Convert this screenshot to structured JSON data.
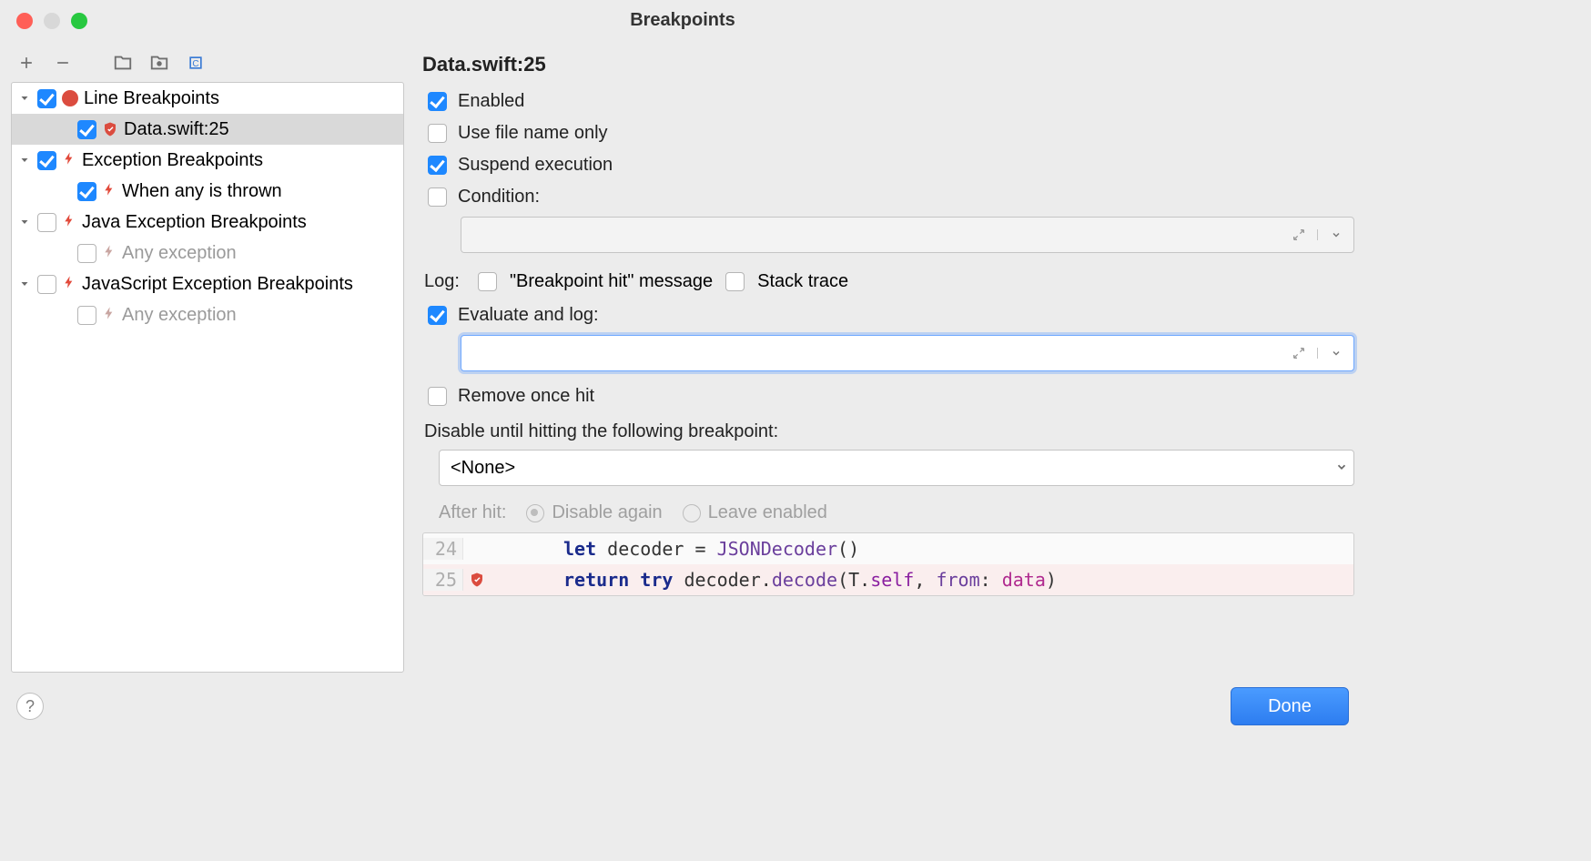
{
  "window": {
    "title": "Breakpoints"
  },
  "tree": {
    "groups": [
      {
        "label": "Line Breakpoints",
        "checked": true,
        "icon": "dot",
        "expanded": true,
        "children": [
          {
            "label": "Data.swift:25",
            "checked": true,
            "icon": "shield",
            "selected": true
          }
        ]
      },
      {
        "label": "Exception Breakpoints",
        "checked": true,
        "icon": "lightning",
        "expanded": true,
        "children": [
          {
            "label": "When any is thrown",
            "checked": true,
            "icon": "lightning"
          }
        ]
      },
      {
        "label": "Java Exception Breakpoints",
        "checked": false,
        "icon": "lightning",
        "expanded": true,
        "children": [
          {
            "label": "Any exception",
            "checked": false,
            "icon": "lightning",
            "muted": true
          }
        ]
      },
      {
        "label": "JavaScript Exception Breakpoints",
        "checked": false,
        "icon": "lightning",
        "expanded": true,
        "children": [
          {
            "label": "Any exception",
            "checked": false,
            "icon": "lightning",
            "muted": true
          }
        ]
      }
    ]
  },
  "detail": {
    "title": "Data.swift:25",
    "enabled_label": "Enabled",
    "enabled": true,
    "filename_only_label": "Use file name only",
    "filename_only": false,
    "suspend_label": "Suspend execution",
    "suspend": true,
    "condition_label": "Condition:",
    "condition_checked": false,
    "condition_value": "",
    "log_label": "Log:",
    "log_bp_hit_label": "\"Breakpoint hit\" message",
    "log_bp_hit": false,
    "log_stack_label": "Stack trace",
    "log_stack": false,
    "eval_label": "Evaluate and log:",
    "eval_checked": true,
    "eval_value": "",
    "remove_once_label": "Remove once hit",
    "remove_once": false,
    "disable_until_label": "Disable until hitting the following breakpoint:",
    "disable_until_value": "<None>",
    "after_hit_label": "After hit:",
    "after_hit_disable_label": "Disable again",
    "after_hit_leave_label": "Leave enabled",
    "after_hit_value": "disable"
  },
  "code": {
    "lines": [
      {
        "num": "24",
        "bp": false,
        "tokens": [
          {
            "t": "let ",
            "c": "kw"
          },
          {
            "t": "decoder ",
            "c": "ident"
          },
          {
            "t": "= ",
            "c": "ident"
          },
          {
            "t": "JSONDecoder",
            "c": "method"
          },
          {
            "t": "()",
            "c": "ident"
          }
        ]
      },
      {
        "num": "25",
        "bp": true,
        "tokens": [
          {
            "t": "return ",
            "c": "kw"
          },
          {
            "t": "try ",
            "c": "kw"
          },
          {
            "t": "decoder",
            "c": "ident"
          },
          {
            "t": ".",
            "c": "ident"
          },
          {
            "t": "decode",
            "c": "method"
          },
          {
            "t": "(T.",
            "c": "ident"
          },
          {
            "t": "self",
            "c": "kw2"
          },
          {
            "t": ", ",
            "c": "ident"
          },
          {
            "t": "from",
            "c": "method"
          },
          {
            "t": ": ",
            "c": "ident"
          },
          {
            "t": "data",
            "c": "param"
          },
          {
            "t": ")",
            "c": "ident"
          }
        ]
      }
    ]
  },
  "footer": {
    "done_label": "Done"
  }
}
